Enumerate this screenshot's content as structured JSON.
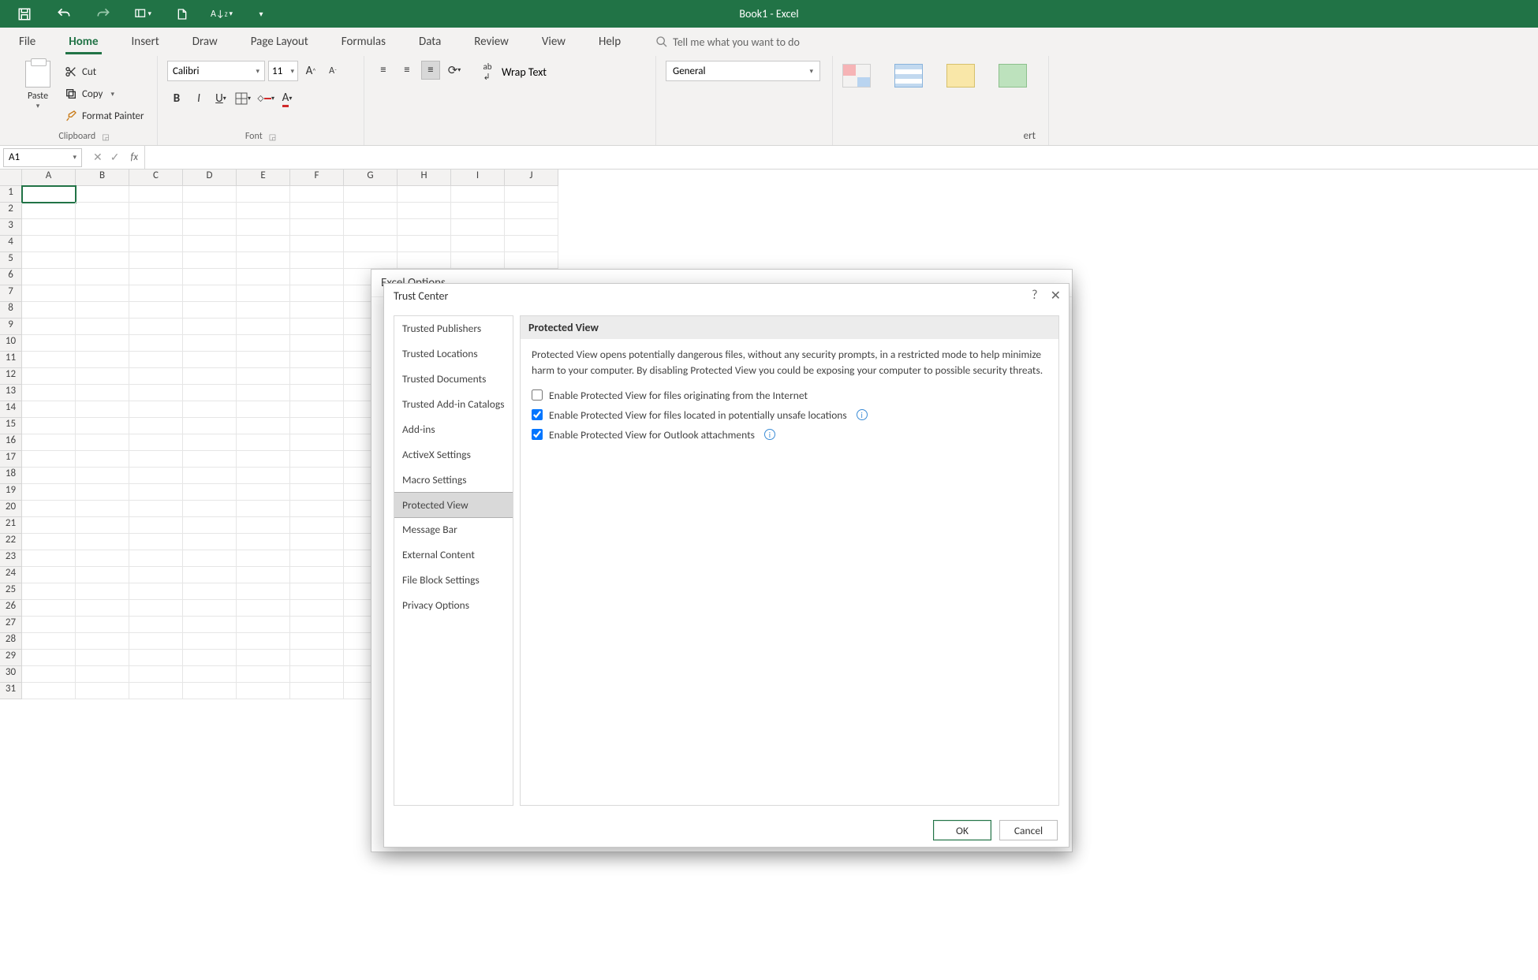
{
  "window": {
    "title": "Book1  -  Excel"
  },
  "qat": {
    "items": [
      "save",
      "undo",
      "redo",
      "mode",
      "newdoc",
      "sort",
      "more"
    ]
  },
  "tabs": [
    "File",
    "Home",
    "Insert",
    "Draw",
    "Page Layout",
    "Formulas",
    "Data",
    "Review",
    "View",
    "Help"
  ],
  "active_tab": "Home",
  "tellme": "Tell me what you want to do",
  "ribbon": {
    "clipboard": {
      "label": "Clipboard",
      "paste": "Paste",
      "cut": "Cut",
      "copy": "Copy",
      "format_painter": "Format Painter"
    },
    "font": {
      "label": "Font",
      "name": "Calibri",
      "size": "11"
    },
    "number": {
      "format": "General"
    },
    "alignment": {
      "wrap": "Wrap Text"
    },
    "truncated": "ert"
  },
  "namebox": "A1",
  "columns": [
    "A",
    "B",
    "C",
    "D",
    "E",
    "F"
  ],
  "rows": 31,
  "excel_options_title": "Excel Options",
  "trust_center": {
    "title": "Trust Center",
    "nav": [
      "Trusted Publishers",
      "Trusted Locations",
      "Trusted Documents",
      "Trusted Add-in Catalogs",
      "Add-ins",
      "ActiveX Settings",
      "Macro Settings",
      "Protected View",
      "Message Bar",
      "External Content",
      "File Block Settings",
      "Privacy Options"
    ],
    "selected_nav": "Protected View",
    "header": "Protected View",
    "desc": "Protected View opens potentially dangerous files, without any security prompts, in a restricted mode to help minimize harm to your computer. By disabling Protected View you could be exposing your computer to possible security threats.",
    "opt1": {
      "label": "Enable Protected View for files originating from the Internet",
      "checked": false,
      "info": false
    },
    "opt2": {
      "label": "Enable Protected View for files located in potentially unsafe locations",
      "checked": true,
      "info": true
    },
    "opt3": {
      "label": "Enable Protected View for Outlook attachments",
      "checked": true,
      "info": true
    },
    "ok": "OK",
    "cancel": "Cancel"
  }
}
